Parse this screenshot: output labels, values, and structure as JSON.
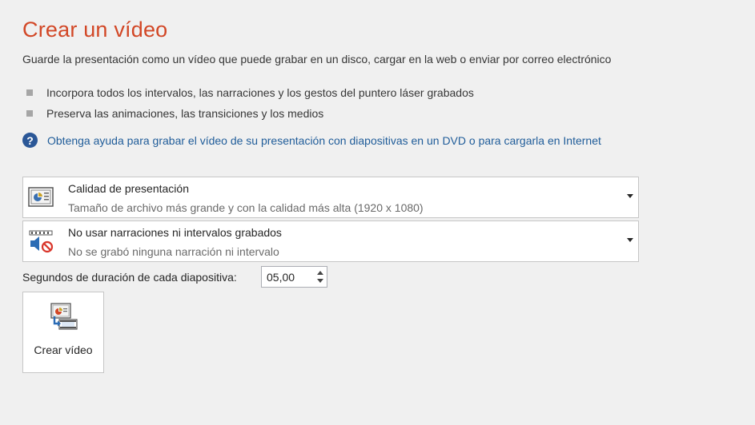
{
  "header": {
    "title": "Crear un vídeo",
    "description": "Guarde la presentación como un vídeo que puede grabar en un disco, cargar en la web o enviar por correo electrónico"
  },
  "features": [
    "Incorpora todos los intervalos, las narraciones y los gestos del puntero láser grabados",
    "Preserva las animaciones, las transiciones y los medios"
  ],
  "help": {
    "icon": "help-question-icon",
    "link_text": "Obtenga ayuda para grabar el vídeo de su presentación con diapositivas en un DVD o para cargarla en Internet"
  },
  "quality_dropdown": {
    "icon": "presentation-quality-icon",
    "selected_title": "Calidad de presentación",
    "selected_subtitle": "Tamaño de archivo más grande y con la calidad más alta (1920 x 1080)"
  },
  "narration_dropdown": {
    "icon": "no-narration-icon",
    "selected_title": "No usar narraciones ni intervalos grabados",
    "selected_subtitle": "No se grabó ninguna narración ni intervalo"
  },
  "duration": {
    "label": "Segundos de duración de cada diapositiva:",
    "value": "05,00"
  },
  "create_button": {
    "icon": "create-video-icon",
    "label": "Crear vídeo"
  },
  "colors": {
    "title": "#d24726",
    "link": "#1f5c99",
    "help_icon": "#2b5797",
    "background": "#f0f0f0"
  }
}
